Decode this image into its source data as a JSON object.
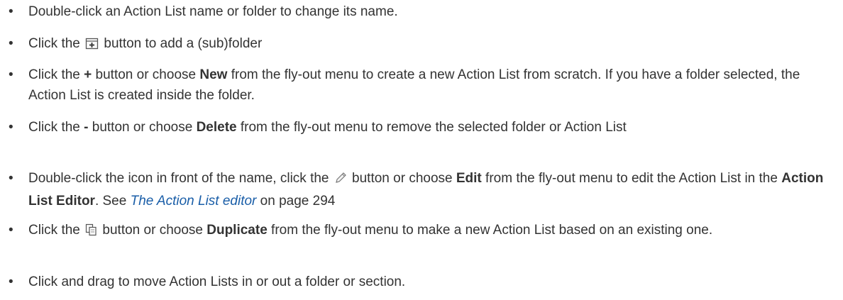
{
  "bullet_char": "•",
  "items": [
    {
      "text": "Double-click an Action List name or folder to change its name."
    },
    {
      "pre": "Click the",
      "icon": "add-folder-icon",
      "post": " button to add a (sub)folder"
    },
    {
      "pre": "Click the ",
      "sym": "+",
      "mid": " button or choose ",
      "bold": "New",
      "post": " from the fly-out menu to create a new Action List from scratch. If you have a folder selected, the Action List is created inside the folder."
    },
    {
      "pre": "Click the ",
      "sym": "-",
      "mid": " button or choose ",
      "bold": "Delete",
      "post": " from the fly-out menu to remove the selected folder or Action List"
    },
    {
      "pre": "Double-click the icon in front of the name, click the",
      "icon": "pencil-icon",
      "mid": " button or choose ",
      "bold": "Edit",
      "mid2": " from the fly-out menu to edit the Action List in the ",
      "bold2": "Action List Editor",
      "mid3": ". See ",
      "link": "The Action List editor",
      "post": " on page 294"
    },
    {
      "pre": "Click the",
      "icon": "duplicate-icon",
      "mid": " button or choose ",
      "bold": "Duplicate",
      "post": " from the fly-out menu to make a new Action List based on an existing one."
    },
    {
      "text": "Click and drag to move Action Lists in or out a folder or section."
    }
  ]
}
